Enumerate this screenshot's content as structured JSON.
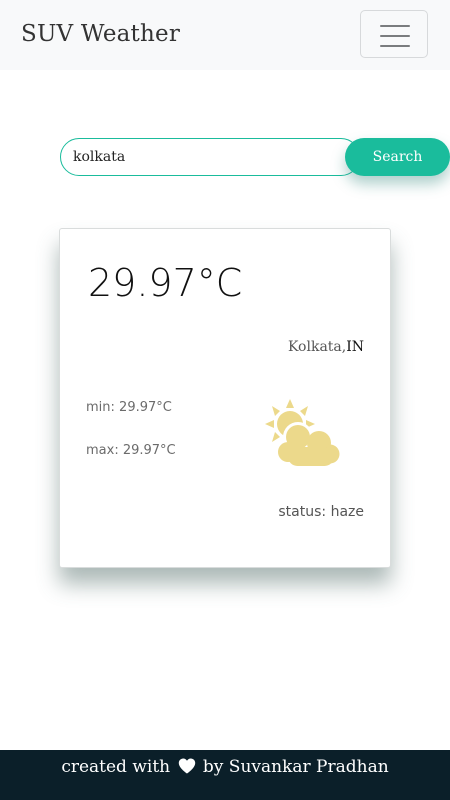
{
  "navbar": {
    "brand": "SUV Weather",
    "menu_icon": "hamburger-menu-icon"
  },
  "search": {
    "value": "kolkata",
    "button_label": "Search"
  },
  "weather": {
    "temperature": "29.97°C",
    "city": "Kolkata,",
    "country": "IN",
    "min_label": "min:",
    "min_value": "29.97°C",
    "max_label": "max:",
    "max_value": "29.97°C",
    "status_label": "status:",
    "status_value": "haze",
    "icon": "partly-cloudy-sun-icon"
  },
  "footer": {
    "prefix": "created with",
    "heart_icon": "heart-icon",
    "suffix": "by Suvankar Pradhan"
  },
  "colors": {
    "accent": "#1abc9c",
    "navbar_bg": "#f8f9fa",
    "footer_bg": "#0b1f29",
    "icon_yellow": "#ecd98b"
  }
}
